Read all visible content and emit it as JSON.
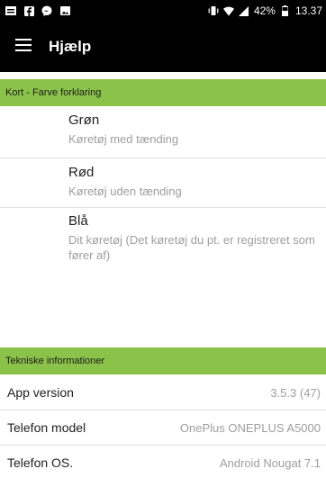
{
  "status_bar": {
    "battery_percent": "42%",
    "time": "13.37",
    "icons": [
      "message-icon",
      "facebook-icon",
      "messenger-icon",
      "gallery-icon",
      "vibrate-icon",
      "wifi-icon",
      "signal-icon",
      "battery-icon"
    ]
  },
  "app_bar": {
    "title": "Hjælp",
    "menu_icon": "hamburger-menu-icon"
  },
  "legend_section": {
    "header": "Kort - Farve forklaring",
    "items": [
      {
        "title": "Grøn",
        "description": "Køretøj med tænding"
      },
      {
        "title": "Rød",
        "description": "Køretøj uden tænding"
      },
      {
        "title": "Blå",
        "description": "Dit køretøj (Det køretøj du pt. er registreret som fører af)"
      }
    ]
  },
  "tech_section": {
    "header": "Tekniske informationer",
    "rows": [
      {
        "label": "App version",
        "value": "3.5.3 (47)"
      },
      {
        "label": "Telefon model",
        "value": "OnePlus ONEPLUS A5000"
      },
      {
        "label": "Telefon OS.",
        "value": "Android Nougat 7.1"
      }
    ]
  },
  "colors": {
    "accent_green": "#8bc34a",
    "app_bar": "#000000",
    "secondary_text": "#9e9e9e"
  }
}
